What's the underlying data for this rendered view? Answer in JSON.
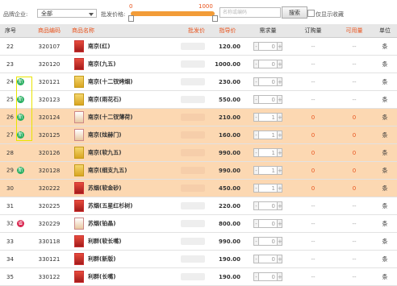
{
  "filter": {
    "brand_label": "品牌企业:",
    "brand_value": "全部",
    "price_label": "批发价格:",
    "price_min": "0",
    "price_max": "1000",
    "search_placeholder": "名称或编码",
    "search_button": "搜索",
    "favorites_label": "仅显示收藏"
  },
  "table": {
    "headers": [
      "序号",
      "商品编码",
      "商品名称",
      "批发价",
      "指导价",
      "需求量",
      "订购量",
      "可用量",
      "单位"
    ],
    "rows": [
      {
        "idx": "22",
        "code": "320107",
        "name": "南京(红)",
        "price": "120.00",
        "qty": "0",
        "ordered": "--",
        "avail": "--",
        "unit": "条",
        "hl": false,
        "badge": "",
        "thumb": "red"
      },
      {
        "idx": "23",
        "code": "320120",
        "name": "南京(九五)",
        "price": "1000.00",
        "qty": "0",
        "ordered": "--",
        "avail": "--",
        "unit": "条",
        "hl": false,
        "badge": "",
        "thumb": "red"
      },
      {
        "idx": "24",
        "code": "320121",
        "name": "南京(十二钗烤烟)",
        "price": "230.00",
        "qty": "0",
        "ordered": "--",
        "avail": "--",
        "unit": "条",
        "hl": false,
        "badge": "新",
        "thumb": "gold"
      },
      {
        "idx": "25",
        "code": "320123",
        "name": "南京(雨花石)",
        "price": "550.00",
        "qty": "0",
        "ordered": "--",
        "avail": "--",
        "unit": "条",
        "hl": false,
        "badge": "新",
        "thumb": "gold"
      },
      {
        "idx": "26",
        "code": "320124",
        "name": "南京(十二钗薄荷)",
        "price": "210.00",
        "qty": "1",
        "ordered": "0",
        "avail": "0",
        "unit": "条",
        "hl": true,
        "badge": "新",
        "thumb": "wh"
      },
      {
        "idx": "27",
        "code": "320125",
        "name": "南京(炫赫门)",
        "price": "160.00",
        "qty": "1",
        "ordered": "0",
        "avail": "0",
        "unit": "条",
        "hl": true,
        "badge": "新",
        "thumb": "wh"
      },
      {
        "idx": "28",
        "code": "320126",
        "name": "南京(软九五)",
        "price": "990.00",
        "qty": "1",
        "ordered": "0",
        "avail": "0",
        "unit": "条",
        "hl": true,
        "badge": "",
        "thumb": "gold"
      },
      {
        "idx": "29",
        "code": "320128",
        "name": "南京(细支九五)",
        "price": "990.00",
        "qty": "1",
        "ordered": "0",
        "avail": "0",
        "unit": "条",
        "hl": true,
        "badge": "新",
        "thumb": "gold"
      },
      {
        "idx": "30",
        "code": "320222",
        "name": "苏烟(软金砂)",
        "price": "450.00",
        "qty": "1",
        "ordered": "0",
        "avail": "0",
        "unit": "条",
        "hl": true,
        "badge": "",
        "thumb": "red"
      },
      {
        "idx": "31",
        "code": "320225",
        "name": "苏烟(五星红杉树)",
        "price": "220.00",
        "qty": "0",
        "ordered": "--",
        "avail": "--",
        "unit": "条",
        "hl": false,
        "badge": "",
        "thumb": "red"
      },
      {
        "idx": "32",
        "code": "320229",
        "name": "苏烟(铂晶)",
        "price": "800.00",
        "qty": "0",
        "ordered": "--",
        "avail": "--",
        "unit": "条",
        "hl": false,
        "badge": "省",
        "thumb": "wh"
      },
      {
        "idx": "33",
        "code": "330118",
        "name": "利群(软长嘴)",
        "price": "990.00",
        "qty": "0",
        "ordered": "--",
        "avail": "--",
        "unit": "条",
        "hl": false,
        "badge": "",
        "thumb": "red"
      },
      {
        "idx": "34",
        "code": "330121",
        "name": "利群(新版)",
        "price": "190.00",
        "qty": "0",
        "ordered": "--",
        "avail": "--",
        "unit": "条",
        "hl": false,
        "badge": "",
        "thumb": "red"
      },
      {
        "idx": "35",
        "code": "330122",
        "name": "利群(长嘴)",
        "price": "190.00",
        "qty": "0",
        "ordered": "--",
        "avail": "--",
        "unit": "条",
        "hl": false,
        "badge": "",
        "thumb": "red"
      }
    ]
  },
  "colors": {
    "accent": "#f29c38",
    "highlight": "#fcd8b2",
    "new_badge": "#27ae60",
    "prov_badge": "#d9254f",
    "link": "#e8541e"
  }
}
